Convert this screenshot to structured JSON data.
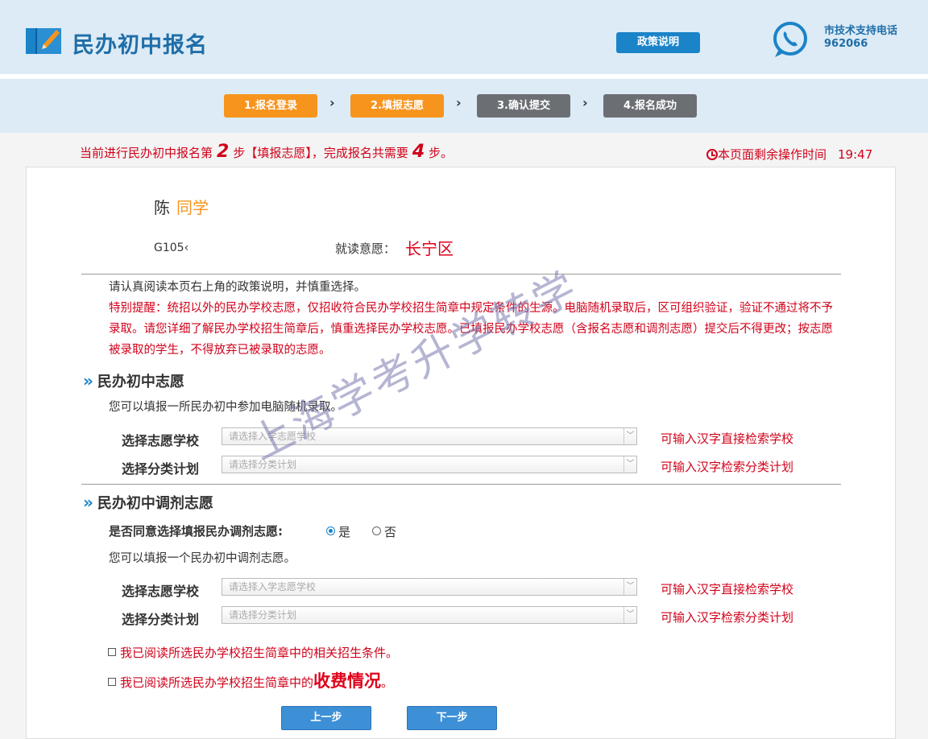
{
  "header": {
    "title": "民办初中报名",
    "policy_button": "政策说明",
    "support_label": "市技术支持电话",
    "support_number": "962066"
  },
  "steps": [
    {
      "label": "1.报名登录",
      "status": "done"
    },
    {
      "label": "2.填报志愿",
      "status": "current"
    },
    {
      "label": "3.确认提交",
      "status": "pending"
    },
    {
      "label": "4.报名成功",
      "status": "pending"
    }
  ],
  "progress": {
    "prefix": "当前进行民办初中报名第",
    "current_step": "2",
    "middle": "步【填报志愿】，完成报名共需要",
    "total_steps": "4",
    "suffix": "步。"
  },
  "timer": {
    "label": "本页面剩余操作时间",
    "remaining": "19:47"
  },
  "student": {
    "surname": "陈",
    "suffix": "同学",
    "id": "G105‹",
    "intent_label": "就读意愿：",
    "intent_value": "长宁区"
  },
  "notes": {
    "instruction": "请认真阅读本页右上角的政策说明，并慎重选择。",
    "warning": "特别提醒：统招以外的民办学校志愿，仅招收符合民办学校招生简章中规定条件的生源。电脑随机录取后，区可组织验证，验证不通过将不予录取。请您详细了解民办学校招生简章后，慎重选择民办学校志愿。已填报民办学校志愿（含报名志愿和调剂志愿）提交后不得更改；按志愿被录取的学生，不得放弃已被录取的志愿。"
  },
  "section1": {
    "title": "民办初中志愿",
    "description": "您可以填报一所民办初中参加电脑随机录取。",
    "school_label": "选择志愿学校",
    "school_placeholder": "请选择入学志愿学校",
    "school_hint": "可输入汉字直接检索学校",
    "plan_label": "选择分类计划",
    "plan_placeholder": "请选择分类计划",
    "plan_hint": "可输入汉字检索分类计划"
  },
  "section2": {
    "title": "民办初中调剂志愿",
    "agree_question": "是否同意选择填报民办调剂志愿:",
    "option_yes": "是",
    "option_no": "否",
    "selected": "是",
    "description": "您可以填报一个民办初中调剂志愿。",
    "school_label": "选择志愿学校",
    "school_placeholder": "请选择入学志愿学校",
    "school_hint": "可输入汉字直接检索学校",
    "plan_label": "选择分类计划",
    "plan_placeholder": "请选择分类计划",
    "plan_hint": "可输入汉字检索分类计划"
  },
  "confirm": {
    "check1": "我已阅读所选民办学校招生简章中的相关招生条件。",
    "check2_prefix": "我已阅读所选民办学校招生简章中的",
    "check2_emphasis": "收费情况",
    "check2_suffix": "。",
    "check1_checked": false,
    "check2_checked": false
  },
  "buttons": {
    "prev": "上一步",
    "next": "下一步"
  },
  "watermark": "上海学考升学转学",
  "colors": {
    "brand_blue": "#1f6ea8",
    "button_blue": "#1b83c8",
    "step_active": "#f7941d",
    "step_inactive": "#6b6f73",
    "alert_red": "#d0021b"
  }
}
